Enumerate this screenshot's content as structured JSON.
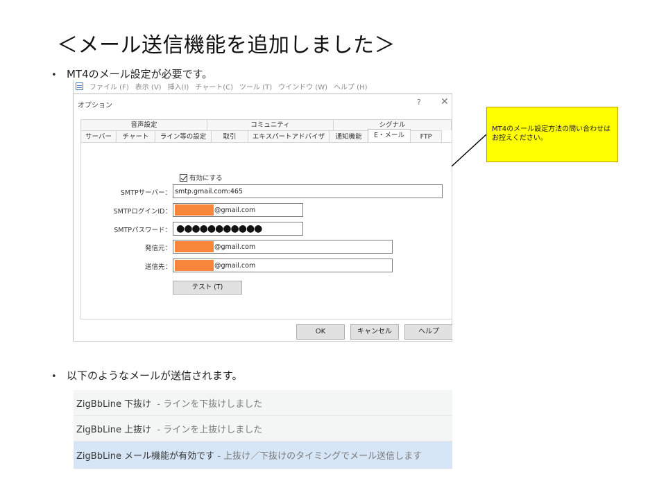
{
  "slide": {
    "title": "＜メール送信機能を追加しました＞",
    "bullet1": "MT4のメール設定が必要です。",
    "bullet2": "以下のようなメールが送信されます。",
    "bullet_glyph": "•"
  },
  "mt4": {
    "menu": [
      "ファイル (F)",
      "表示 (V)",
      "挿入(I)",
      "チャート(C)",
      "ツール (T)",
      "ウインドウ (W)",
      "ヘルプ (H)"
    ],
    "dialog": {
      "title": "オプション",
      "help_glyph": "?",
      "close_glyph": "✕",
      "tabs_row1": [
        "音声設定",
        "コミュニティ",
        "シグナル"
      ],
      "tabs_row2": [
        "サーバー",
        "チャート",
        "ライン等の設定",
        "取引",
        "エキスパートアドバイザ",
        "通知機能",
        "E・メール",
        "FTP"
      ],
      "active_tab": "E・メール",
      "enable_label": "有効にする",
      "enable_checked": true,
      "fields": {
        "smtp_server_label": "SMTPサーバー：",
        "smtp_server_value": "smtp.gmail.com:465",
        "smtp_login_label": "SMTPログインID：",
        "smtp_login_value": "@gmail.com",
        "smtp_password_label": "SMTPパスワード：",
        "smtp_password_value": "●●●●●●●●●●●",
        "from_label": "発信元：",
        "from_value": "@gmail.com",
        "to_label": "送信先：",
        "to_value": "@gmail.com"
      },
      "test_button": "テスト (T)",
      "ok_button": "OK",
      "cancel_button": "キャンセル",
      "help_button": "ヘルプ"
    }
  },
  "callout": {
    "text": "MT4のメール設定方法の問い合わせはお控えください。"
  },
  "notifications": [
    {
      "name": "ZigBbLine 下抜け",
      "message": "  - ラインを下抜けしました"
    },
    {
      "name": "ZigBbLine 上抜け",
      "message": "  - ラインを上抜けしました"
    },
    {
      "name": "ZigBbLine メール機能が有効です",
      "message": " - 上抜け／下抜けのタイミングでメール送信します"
    }
  ],
  "colors": {
    "redaction": "#f7863a",
    "callout_bg": "#ffff00",
    "highlight_row": "#d6e6f7"
  }
}
